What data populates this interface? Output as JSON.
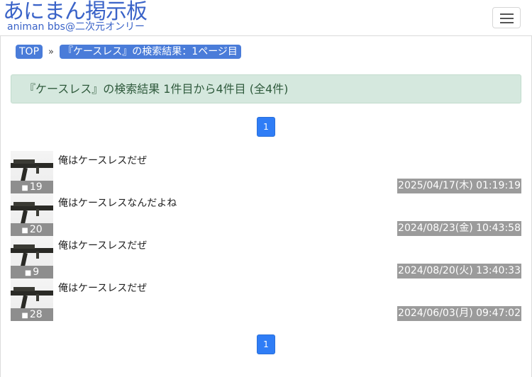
{
  "site": {
    "title": "あにまん掲示板",
    "subtitle": "animan bbs@二次元オンリー"
  },
  "breadcrumb": {
    "top": "TOP",
    "separator": "»",
    "current": "『ケースレス』の検索結果：1ページ目"
  },
  "search": {
    "summary": "『ケースレス』の検索結果 1件目から4件目 (全4件)"
  },
  "pagination": {
    "current_page": "1"
  },
  "threads": [
    {
      "title": "俺はケースレスだぜ",
      "replies": "19",
      "date": "2025/04/17(木) 01:19:19"
    },
    {
      "title": "俺はケースレスなんだよね",
      "replies": "20",
      "date": "2024/08/23(金) 10:43:58"
    },
    {
      "title": "俺はケースレスだぜ",
      "replies": "9",
      "date": "2024/08/20(火) 13:40:33"
    },
    {
      "title": "俺はケースレスだぜ",
      "replies": "28",
      "date": "2024/06/03(月) 09:47:02"
    }
  ],
  "icons": {
    "menu": "hamburger-icon",
    "comment": "comment-icon"
  }
}
